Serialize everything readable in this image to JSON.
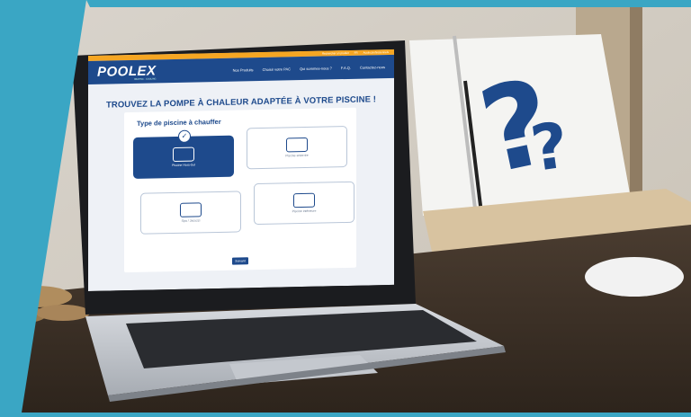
{
  "site": {
    "logo": "POOLEX",
    "logo_sub": "HEATING · COOLING",
    "topbar": [
      "Rechercher un produit",
      "FR",
      "Accès professionnels"
    ],
    "nav": [
      "Nos Produits",
      "Choisir votre PAC",
      "Qui sommes-nous ?",
      "F.A.Q.",
      "Contactez-nous"
    ],
    "headline": "TROUVEZ LA POMPE À CHALEUR ADAPTÉE À VOTRE PISCINE !",
    "section_title": "Type de piscine à chauffer",
    "options": [
      {
        "label": "Piscine Hors-Sol",
        "selected": true
      },
      {
        "label": "Piscine enterrée",
        "selected": false
      },
      {
        "label": "Spa / Jacuzzi",
        "selected": false
      },
      {
        "label": "Piscine intérieure",
        "selected": false
      }
    ],
    "button": "Suivant"
  },
  "overlay": {
    "symbol": "?"
  },
  "colors": {
    "brand_blue": "#1e4a8c",
    "accent_orange": "#f5a623",
    "teal_band": "#3aa6c4"
  }
}
